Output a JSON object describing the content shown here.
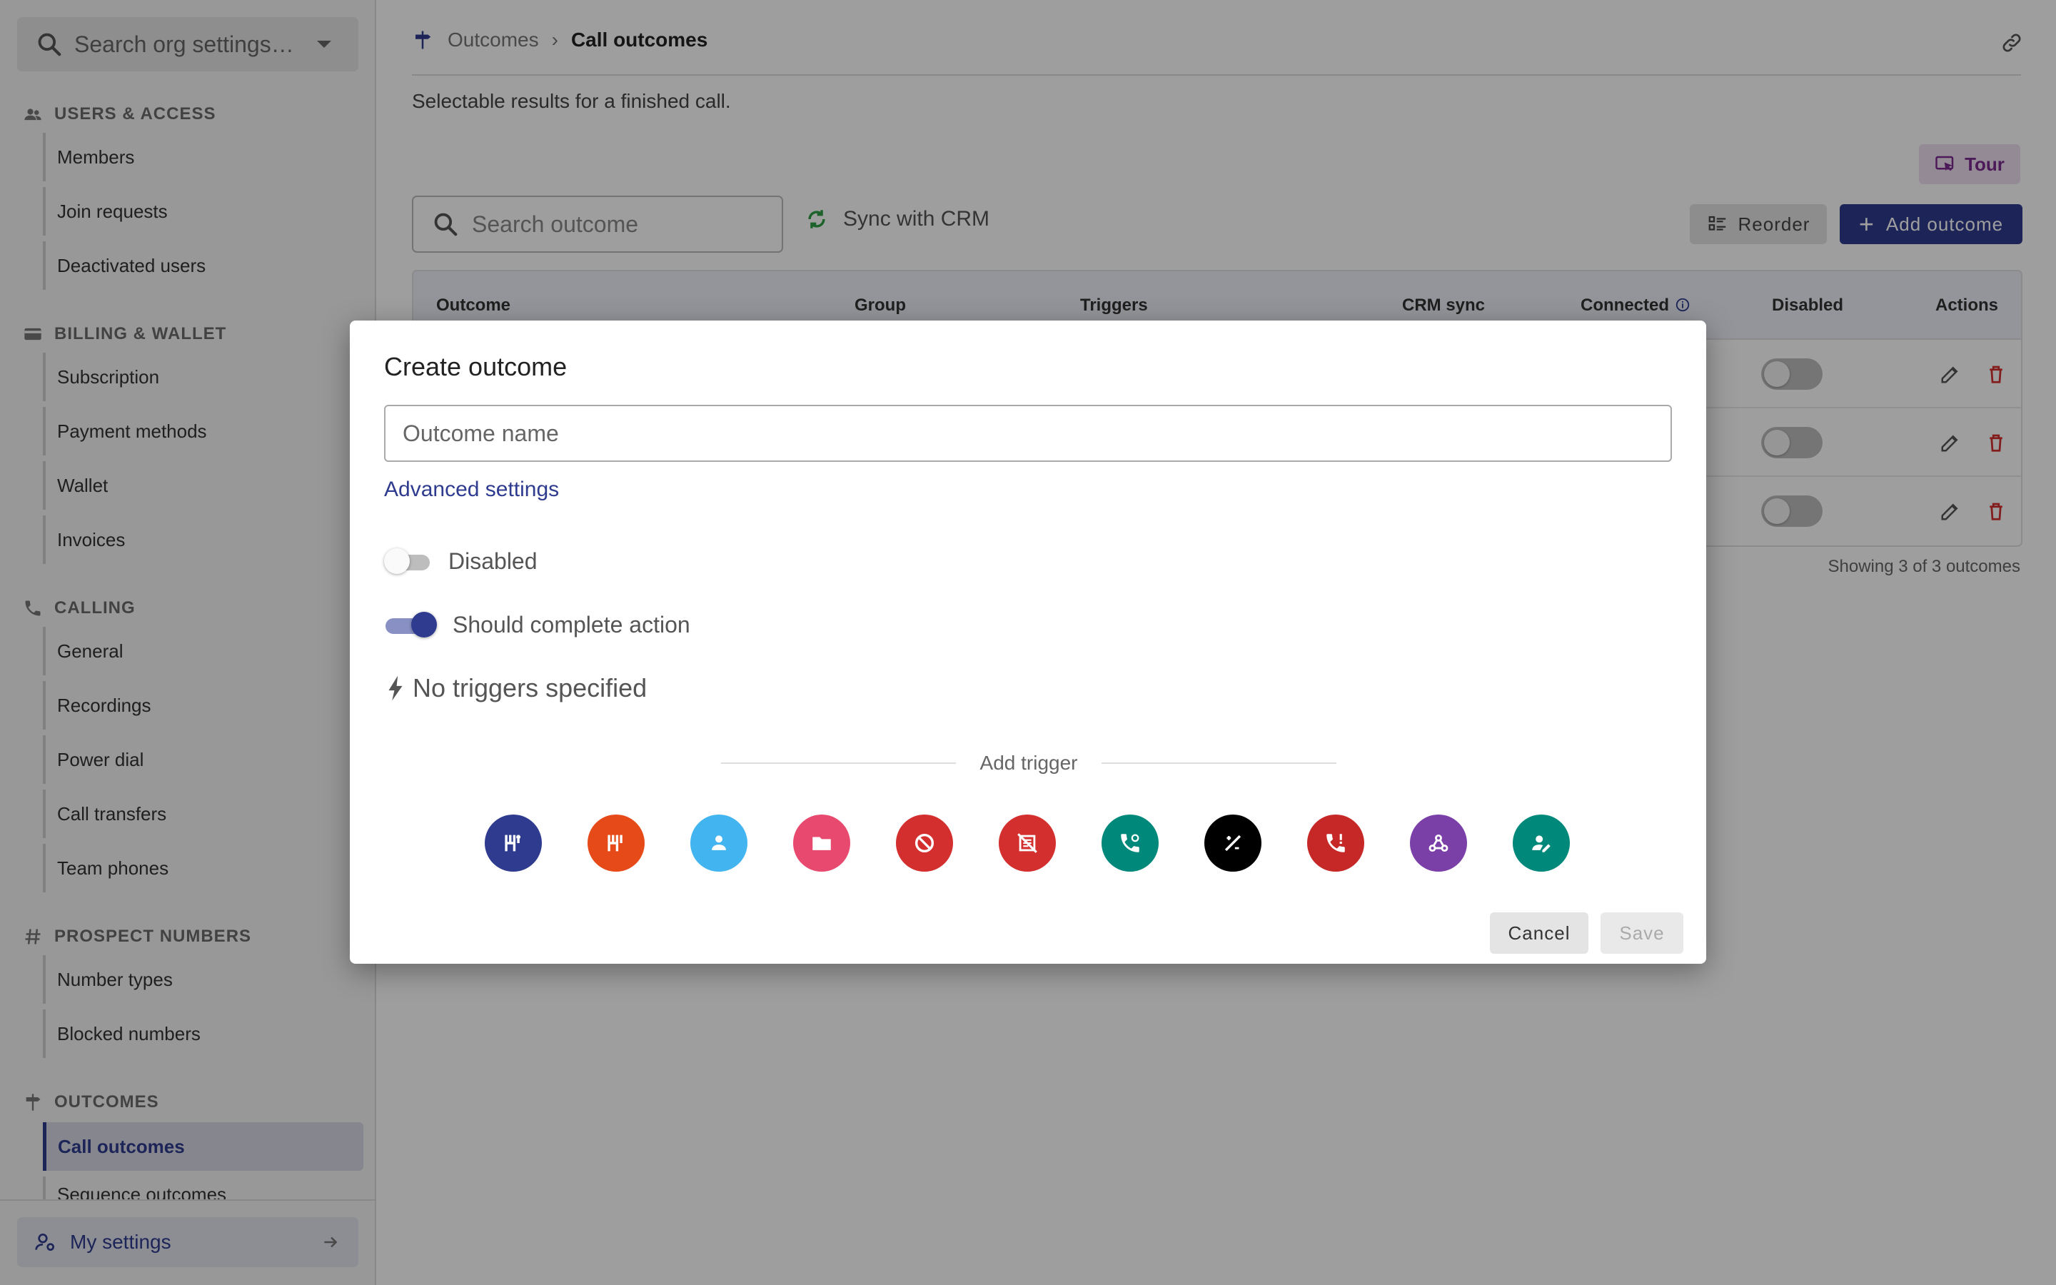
{
  "sidebar": {
    "search_placeholder": "Search org settings…",
    "sections": [
      {
        "title": "USERS & ACCESS",
        "icon": "users-icon",
        "items": [
          "Members",
          "Join requests",
          "Deactivated users"
        ]
      },
      {
        "title": "BILLING & WALLET",
        "icon": "card-icon",
        "items": [
          "Subscription",
          "Payment methods",
          "Wallet",
          "Invoices"
        ]
      },
      {
        "title": "CALLING",
        "icon": "phone-icon",
        "items": [
          "General",
          "Recordings",
          "Power dial",
          "Call transfers",
          "Team phones"
        ]
      },
      {
        "title": "PROSPECT NUMBERS",
        "icon": "hash-icon",
        "items": [
          "Number types",
          "Blocked numbers"
        ]
      },
      {
        "title": "OUTCOMES",
        "icon": "signpost-icon",
        "items": [
          "Call outcomes",
          "Sequence outcomes"
        ]
      }
    ],
    "active_item": "Call outcomes",
    "my_settings": "My settings"
  },
  "header": {
    "breadcrumb_parent": "Outcomes",
    "breadcrumb_current": "Call outcomes",
    "subtitle": "Selectable results for a finished call."
  },
  "toolbar": {
    "tour_label": "Tour",
    "search_placeholder": "Search outcome",
    "sync_label": "Sync with CRM",
    "reorder_label": "Reorder",
    "add_label": "Add outcome"
  },
  "table": {
    "columns": [
      "Outcome",
      "Group",
      "Triggers",
      "CRM sync",
      "Connected",
      "Disabled",
      "Actions"
    ],
    "rows": [
      {
        "disabled": false
      },
      {
        "disabled": false
      },
      {
        "disabled": false
      }
    ],
    "footer": "Showing 3 of 3 outcomes"
  },
  "modal": {
    "title": "Create outcome",
    "name_placeholder": "Outcome name",
    "advanced_link": "Advanced settings",
    "disabled_label": "Disabled",
    "disabled_on": false,
    "complete_label": "Should complete action",
    "complete_on": true,
    "no_triggers": "No triggers specified",
    "add_trigger": "Add trigger",
    "triggers": [
      {
        "icon": "sequence-start-icon",
        "color": "#2f3b8f"
      },
      {
        "icon": "sequence-stop-icon",
        "color": "#e64a19"
      },
      {
        "icon": "contact-icon",
        "color": "#42b4f0"
      },
      {
        "icon": "folder-icon",
        "color": "#e84a6f"
      },
      {
        "icon": "block-icon",
        "color": "#d32f2f"
      },
      {
        "icon": "no-call-icon",
        "color": "#d32f2f"
      },
      {
        "icon": "callback-icon",
        "color": "#00897b"
      },
      {
        "icon": "no-answer-icon",
        "color": "#000000"
      },
      {
        "icon": "urgent-call-icon",
        "color": "#c62828"
      },
      {
        "icon": "webhook-icon",
        "color": "#7b3fa8"
      },
      {
        "icon": "assign-user-icon",
        "color": "#00897b"
      }
    ],
    "cancel_label": "Cancel",
    "save_label": "Save"
  }
}
